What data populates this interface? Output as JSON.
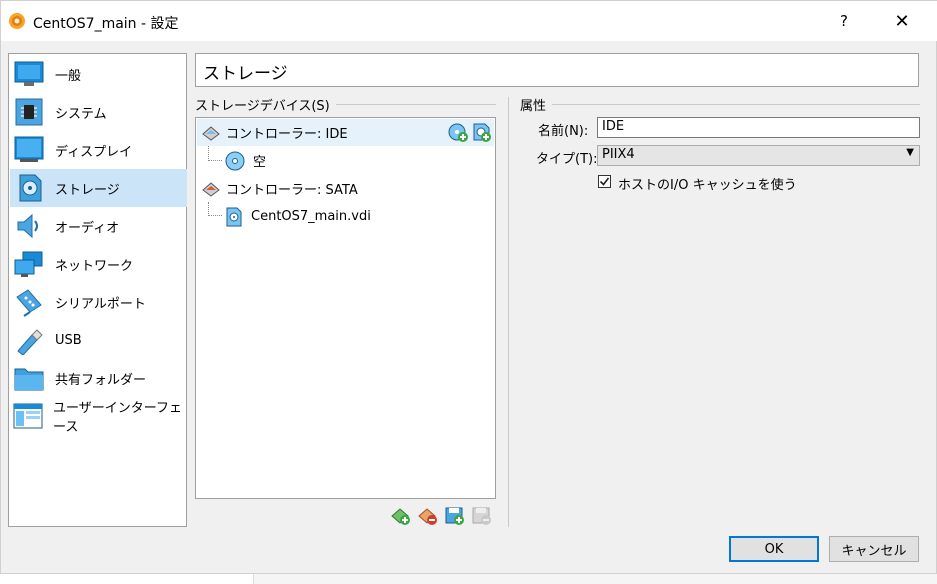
{
  "window": {
    "title": "CentOS7_main - 設定",
    "help": "?",
    "close": "✕"
  },
  "sidebar": {
    "items": [
      {
        "label": "一般",
        "icon": "general-icon"
      },
      {
        "label": "システム",
        "icon": "system-icon"
      },
      {
        "label": "ディスプレイ",
        "icon": "display-icon"
      },
      {
        "label": "ストレージ",
        "icon": "storage-icon",
        "selected": true
      },
      {
        "label": "オーディオ",
        "icon": "audio-icon"
      },
      {
        "label": "ネットワーク",
        "icon": "network-icon"
      },
      {
        "label": "シリアルポート",
        "icon": "serial-port-icon"
      },
      {
        "label": "USB",
        "icon": "usb-icon"
      },
      {
        "label": "共有フォルダー",
        "icon": "shared-folder-icon"
      },
      {
        "label": "ユーザーインターフェース",
        "icon": "user-interface-icon"
      }
    ]
  },
  "page": {
    "heading": "ストレージ"
  },
  "storage": {
    "group_label": "ストレージデバイス(S)",
    "tree": [
      {
        "label": "コントローラー: IDE",
        "type": "controller"
      },
      {
        "label": "空",
        "type": "optical"
      },
      {
        "label": "コントローラー: SATA",
        "type": "controller"
      },
      {
        "label": "CentOS7_main.vdi",
        "type": "disk"
      }
    ]
  },
  "attributes": {
    "group_label": "属性",
    "name_label": "名前(N):",
    "name_value": "IDE",
    "type_label": "タイプ(T):",
    "type_value": "PIIX4",
    "host_cache_label": "ホストのI/O キャッシュを使う",
    "host_cache_checked": true
  },
  "buttons": {
    "ok": "OK",
    "cancel": "キャンセル"
  },
  "colors": {
    "selection": "#cce4f7",
    "accent": "#0078d7"
  }
}
